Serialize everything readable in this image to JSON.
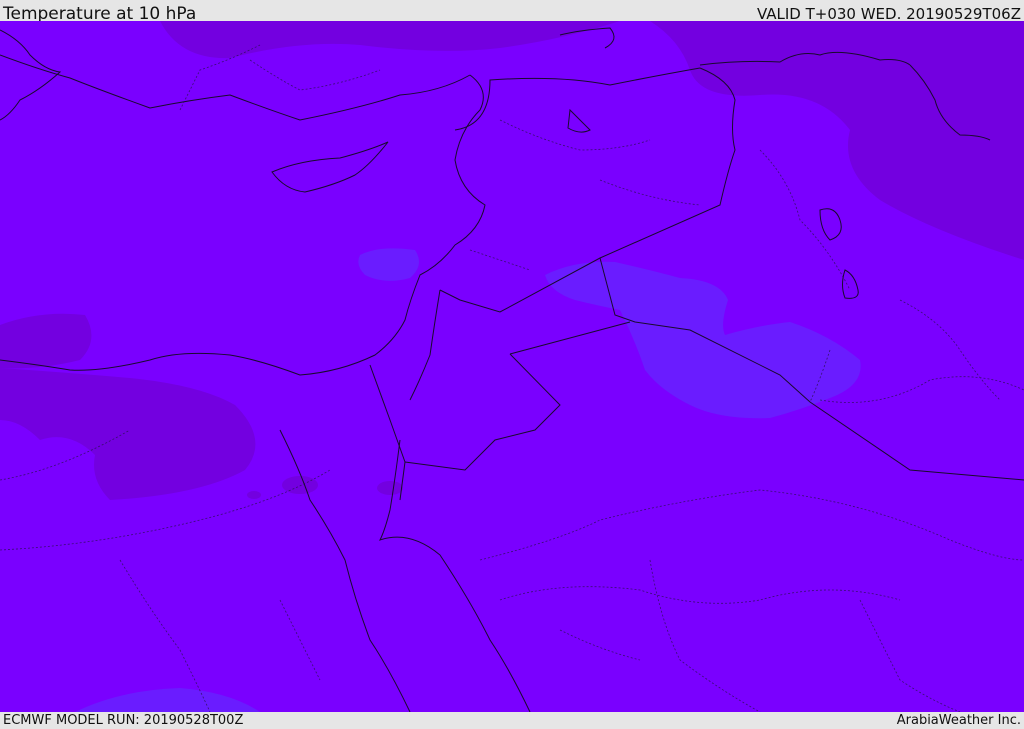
{
  "header": {
    "title": "Temperature at 10 hPa",
    "valid_time": "VALID T+030 WED. 20190529T06Z"
  },
  "footer": {
    "model_run": "ECMWF MODEL RUN: 20190528T00Z",
    "credit": "ArabiaWeather Inc."
  },
  "map": {
    "parameter": "temperature",
    "level": "10 hPa",
    "colors": {
      "base_fill": "#7a00ff",
      "warmer_band": "#7300e0",
      "cooler_band": "#6a1cff",
      "coastline": "#1a0a2e",
      "border": "#2a1050"
    }
  }
}
